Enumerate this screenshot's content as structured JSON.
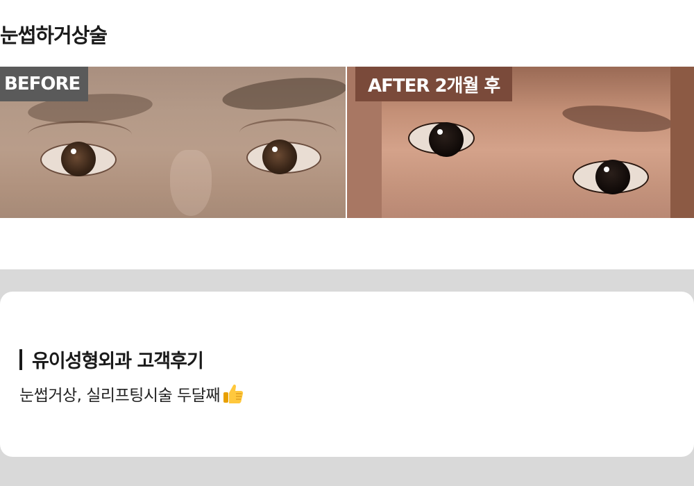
{
  "title": "눈썹하거상술",
  "before_after": {
    "before_label": "BEFORE",
    "after_label": "AFTER 2개월 후"
  },
  "review": {
    "heading": "유이성형외과 고객후기",
    "text": "눈썹거상, 실리프팅시술 두달째",
    "emoji_icon": "thumbs-up-icon"
  },
  "colors": {
    "before_tag": "#5a5a5a",
    "after_tag": "#7a4a3a",
    "background_band": "#d9d9d9"
  }
}
